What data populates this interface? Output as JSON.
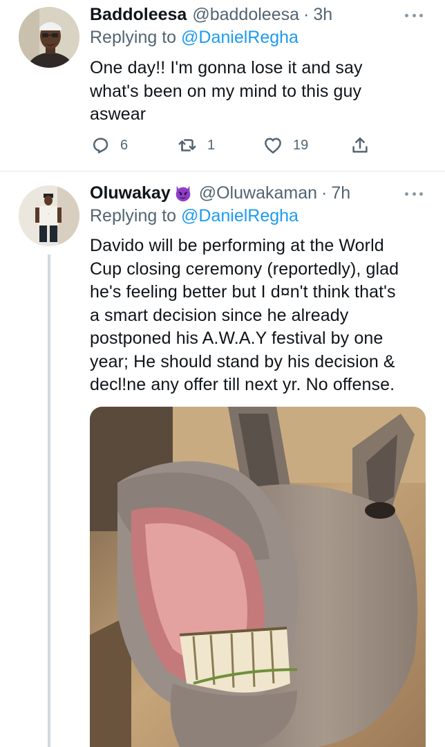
{
  "tweets": [
    {
      "author_name": "Baddoleesa",
      "handle": "@baddoleesa",
      "time": "3h",
      "replying_prefix": "Replying to",
      "replying_to": "@DanielRegha",
      "text": "One day!! I'm gonna lose it and say\nwhat's been on my mind to this guy\naswear",
      "reply_count": "6",
      "retweet_count": "1",
      "like_count": "19"
    },
    {
      "author_name": "Oluwakay",
      "name_emoji": "smiling-imp-emoji",
      "handle": "@Oluwakaman",
      "time": "7h",
      "replying_prefix": "Replying to",
      "replying_to": "@DanielRegha",
      "text": "Davido will be performing at the World\nCup closing ceremony (reportedly), glad\nhe's feeling better but I d¤n't think that's\na smart decision since he already\npostponed his A.W.A.Y festival by one\nyear; He should stand by his decision &\ndecl!ne any  offer till next yr. No offense.",
      "media": "photo of a laughing donkey showing its teeth"
    }
  ],
  "icons": {
    "more": "more-horizontal-icon",
    "reply": "reply-bubble-icon",
    "retweet": "retweet-icon",
    "like": "heart-icon",
    "share": "share-upload-icon"
  },
  "colors": {
    "text": "#0f1419",
    "secondary": "#536471",
    "accent": "#1d9bf0",
    "divider": "#e6ecf0",
    "thread_line": "#cfd9de",
    "emoji": "#8e3ec8"
  }
}
